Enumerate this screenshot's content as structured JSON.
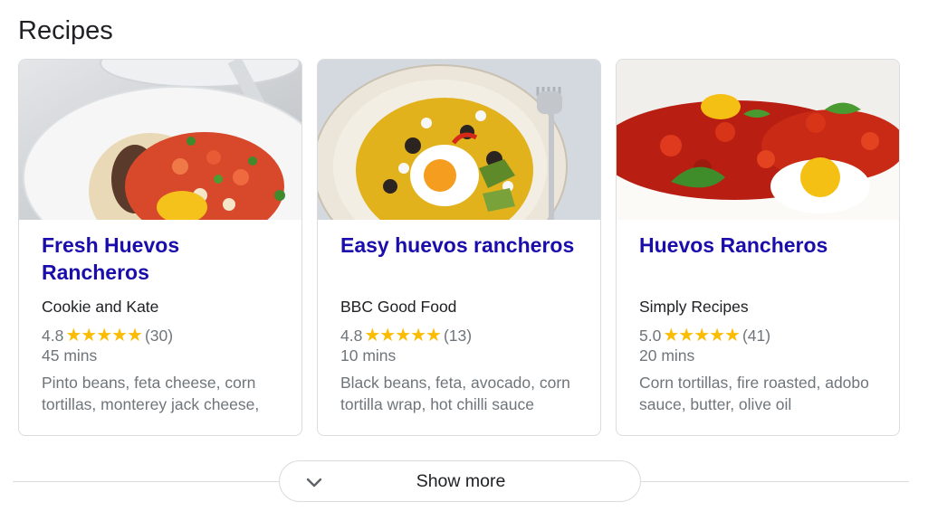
{
  "section": {
    "title": "Recipes"
  },
  "recipes": [
    {
      "title": "Fresh Huevos Rancheros",
      "source": "Cookie and Kate",
      "rating": "4.8",
      "stars": "★★★★★",
      "reviews": "(30)",
      "time": "45 mins",
      "ingredients": "Pinto beans, feta cheese, corn tortillas, monterey jack cheese,",
      "image_icon": "recipe-photo-icon"
    },
    {
      "title": "Easy huevos rancheros",
      "source": "BBC Good Food",
      "rating": "4.8",
      "stars": "★★★★★",
      "reviews": "(13)",
      "time": "10 mins",
      "ingredients": "Black beans, feta, avocado, corn tortilla wrap, hot chilli sauce",
      "image_icon": "recipe-photo-icon"
    },
    {
      "title": "Huevos Rancheros",
      "source": "Simply Recipes",
      "rating": "5.0",
      "stars": "★★★★★",
      "reviews": "(41)",
      "time": "20 mins",
      "ingredients": "Corn tortillas, fire roasted, adobo sauce, butter, olive oil",
      "image_icon": "recipe-photo-icon"
    }
  ],
  "show_more": {
    "label": "Show more",
    "icon": "chevron-down-icon"
  },
  "colors": {
    "link": "#1a0dab",
    "star": "#fbbc04",
    "meta": "#70757a",
    "border": "#dadce0"
  }
}
